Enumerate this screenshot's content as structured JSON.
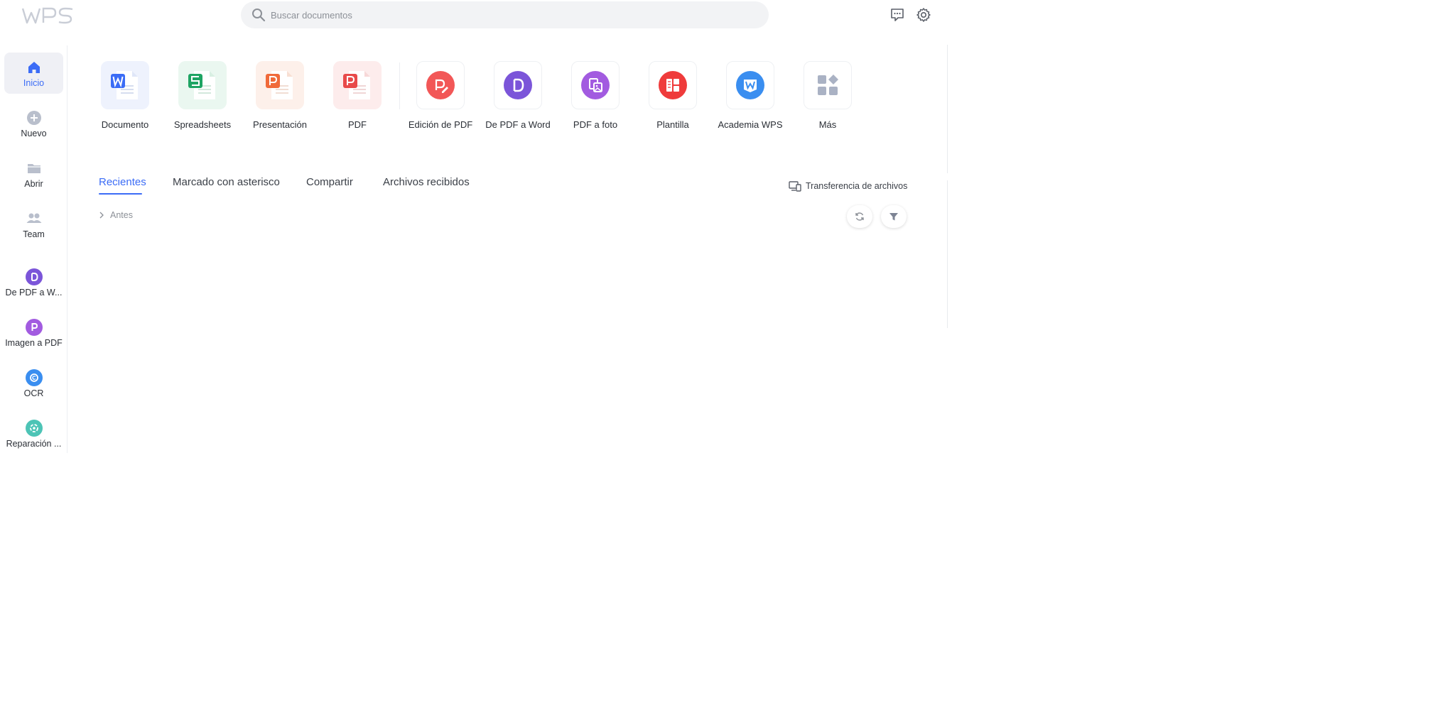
{
  "app": {
    "logo_text": "WPS"
  },
  "search": {
    "placeholder": "Buscar documentos"
  },
  "topbar": {
    "icons": [
      "chat-icon",
      "settings-gear-icon"
    ]
  },
  "sidebar": {
    "items": [
      {
        "label": "Inicio",
        "icon": "home-icon",
        "active": true
      },
      {
        "label": "Nuevo",
        "icon": "plus-circle-icon"
      },
      {
        "label": "Abrir",
        "icon": "folder-icon"
      },
      {
        "label": "Team",
        "icon": "team-icon"
      },
      {
        "label": "De PDF a W...",
        "icon": "pdf-to-word-icon"
      },
      {
        "label": "Imagen a PDF",
        "icon": "image-to-pdf-icon"
      },
      {
        "label": "OCR",
        "icon": "ocr-icon"
      },
      {
        "label": "Reparación ...",
        "icon": "repair-icon"
      }
    ]
  },
  "tiles": [
    {
      "label": "Documento",
      "icon": "writer-doc-icon",
      "color": "#3b6cf6"
    },
    {
      "label": "Spreadsheets",
      "icon": "spreadsheet-icon",
      "color": "#1ea463"
    },
    {
      "label": "Presentación",
      "icon": "presentation-icon",
      "color": "#f06a3a"
    },
    {
      "label": "PDF",
      "icon": "pdf-icon",
      "color": "#e84a4a"
    },
    {
      "label": "Edición de PDF",
      "icon": "pdf-edit-icon",
      "color": "#f25757"
    },
    {
      "label": "De PDF a Word",
      "icon": "pdf-to-word-icon",
      "color": "#7b55d9"
    },
    {
      "label": "PDF a foto",
      "icon": "pdf-to-photo-icon",
      "color": "#a25be0"
    },
    {
      "label": "Plantilla",
      "icon": "template-icon",
      "color": "#ef3b3b"
    },
    {
      "label": "Academia WPS",
      "icon": "academy-icon",
      "color": "#3a8ef0"
    },
    {
      "label": "Más",
      "icon": "more-apps-icon",
      "color": "#aab2c4"
    }
  ],
  "tabs": [
    {
      "label": "Recientes",
      "active": true
    },
    {
      "label": "Marcado con asterisco"
    },
    {
      "label": "Compartir"
    },
    {
      "label": "Archivos recibidos"
    }
  ],
  "file_transfer": {
    "label": "Transferencia de archivos"
  },
  "list": {
    "group_label": "Antes"
  },
  "colors": {
    "accent": "#3b6cf6",
    "sidebar_active_bg": "#eff0f5"
  }
}
